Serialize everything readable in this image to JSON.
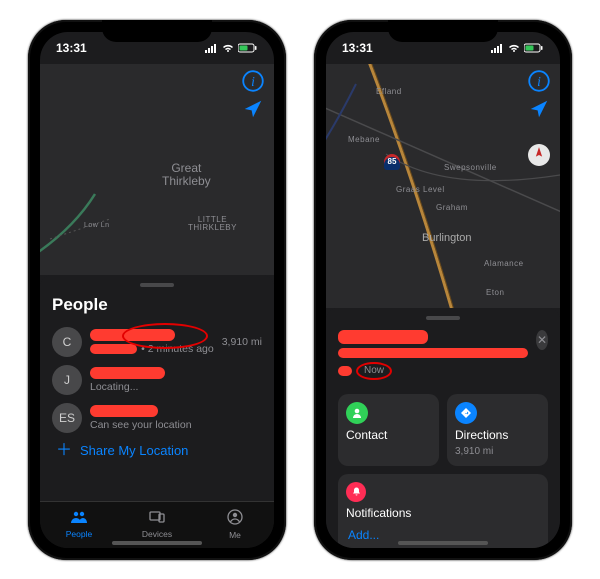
{
  "status": {
    "time": "13:31"
  },
  "map_left": {
    "main_label": "Great\nThirkleby",
    "sub_label": "LITTLE\nTHIRKLEBY",
    "road_label": "Low Ln"
  },
  "map_right": {
    "labels": [
      "Efland",
      "Mebane",
      "Swepsonville",
      "Graas Level",
      "Graham",
      "Burlington",
      "Alamance",
      "Eton"
    ],
    "interstate": "85"
  },
  "sheet_left": {
    "title": "People",
    "people": [
      {
        "initial": "C",
        "timestamp": "• 2 minutes ago",
        "distance": "3,910 mi"
      },
      {
        "initial": "J",
        "status": "Locating..."
      },
      {
        "initial": "ES",
        "status": "Can see your location"
      }
    ],
    "share": "Share My Location"
  },
  "tabs": {
    "people": "People",
    "devices": "Devices",
    "me": "Me"
  },
  "sheet_right": {
    "now": "Now",
    "contact": {
      "title": "Contact"
    },
    "directions": {
      "title": "Directions",
      "sub": "3,910 mi"
    },
    "notifications": "Notifications",
    "add": "Add..."
  },
  "colors": {
    "accent": "#0a84ff",
    "redact": "#ff3b30",
    "contact_icon": "#30d158",
    "directions_icon": "#0a84ff",
    "notif_icon": "#ff2d55"
  }
}
